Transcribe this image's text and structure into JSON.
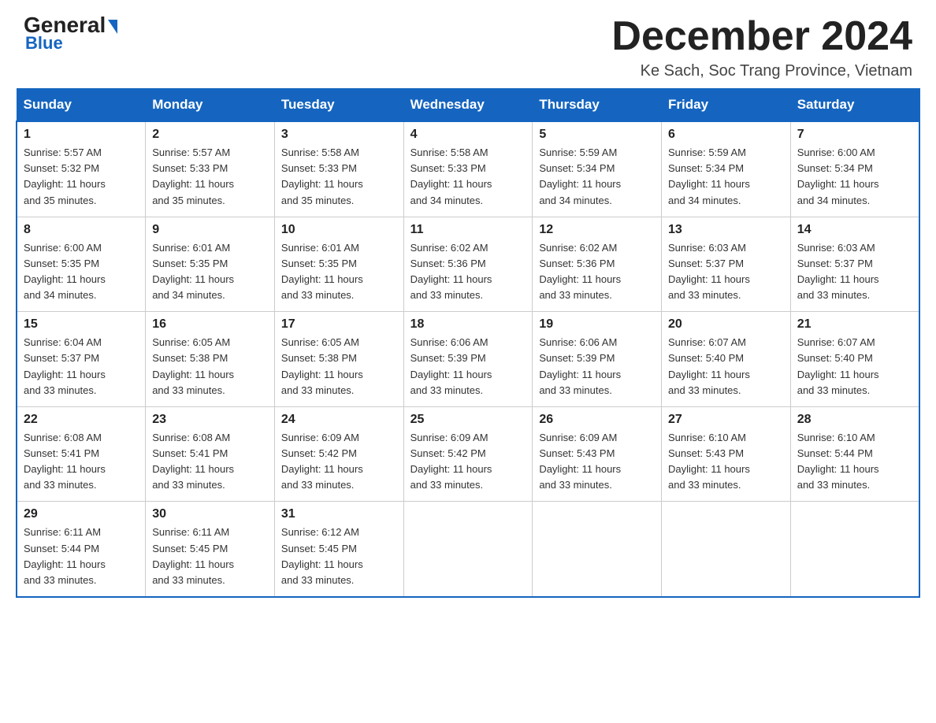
{
  "logo": {
    "name_part1": "General",
    "name_part2": "Blue"
  },
  "header": {
    "month": "December 2024",
    "location": "Ke Sach, Soc Trang Province, Vietnam"
  },
  "days_of_week": [
    "Sunday",
    "Monday",
    "Tuesday",
    "Wednesday",
    "Thursday",
    "Friday",
    "Saturday"
  ],
  "weeks": [
    [
      {
        "day": "1",
        "sunrise": "5:57 AM",
        "sunset": "5:32 PM",
        "daylight": "11 hours and 35 minutes."
      },
      {
        "day": "2",
        "sunrise": "5:57 AM",
        "sunset": "5:33 PM",
        "daylight": "11 hours and 35 minutes."
      },
      {
        "day": "3",
        "sunrise": "5:58 AM",
        "sunset": "5:33 PM",
        "daylight": "11 hours and 35 minutes."
      },
      {
        "day": "4",
        "sunrise": "5:58 AM",
        "sunset": "5:33 PM",
        "daylight": "11 hours and 34 minutes."
      },
      {
        "day": "5",
        "sunrise": "5:59 AM",
        "sunset": "5:34 PM",
        "daylight": "11 hours and 34 minutes."
      },
      {
        "day": "6",
        "sunrise": "5:59 AM",
        "sunset": "5:34 PM",
        "daylight": "11 hours and 34 minutes."
      },
      {
        "day": "7",
        "sunrise": "6:00 AM",
        "sunset": "5:34 PM",
        "daylight": "11 hours and 34 minutes."
      }
    ],
    [
      {
        "day": "8",
        "sunrise": "6:00 AM",
        "sunset": "5:35 PM",
        "daylight": "11 hours and 34 minutes."
      },
      {
        "day": "9",
        "sunrise": "6:01 AM",
        "sunset": "5:35 PM",
        "daylight": "11 hours and 34 minutes."
      },
      {
        "day": "10",
        "sunrise": "6:01 AM",
        "sunset": "5:35 PM",
        "daylight": "11 hours and 33 minutes."
      },
      {
        "day": "11",
        "sunrise": "6:02 AM",
        "sunset": "5:36 PM",
        "daylight": "11 hours and 33 minutes."
      },
      {
        "day": "12",
        "sunrise": "6:02 AM",
        "sunset": "5:36 PM",
        "daylight": "11 hours and 33 minutes."
      },
      {
        "day": "13",
        "sunrise": "6:03 AM",
        "sunset": "5:37 PM",
        "daylight": "11 hours and 33 minutes."
      },
      {
        "day": "14",
        "sunrise": "6:03 AM",
        "sunset": "5:37 PM",
        "daylight": "11 hours and 33 minutes."
      }
    ],
    [
      {
        "day": "15",
        "sunrise": "6:04 AM",
        "sunset": "5:37 PM",
        "daylight": "11 hours and 33 minutes."
      },
      {
        "day": "16",
        "sunrise": "6:05 AM",
        "sunset": "5:38 PM",
        "daylight": "11 hours and 33 minutes."
      },
      {
        "day": "17",
        "sunrise": "6:05 AM",
        "sunset": "5:38 PM",
        "daylight": "11 hours and 33 minutes."
      },
      {
        "day": "18",
        "sunrise": "6:06 AM",
        "sunset": "5:39 PM",
        "daylight": "11 hours and 33 minutes."
      },
      {
        "day": "19",
        "sunrise": "6:06 AM",
        "sunset": "5:39 PM",
        "daylight": "11 hours and 33 minutes."
      },
      {
        "day": "20",
        "sunrise": "6:07 AM",
        "sunset": "5:40 PM",
        "daylight": "11 hours and 33 minutes."
      },
      {
        "day": "21",
        "sunrise": "6:07 AM",
        "sunset": "5:40 PM",
        "daylight": "11 hours and 33 minutes."
      }
    ],
    [
      {
        "day": "22",
        "sunrise": "6:08 AM",
        "sunset": "5:41 PM",
        "daylight": "11 hours and 33 minutes."
      },
      {
        "day": "23",
        "sunrise": "6:08 AM",
        "sunset": "5:41 PM",
        "daylight": "11 hours and 33 minutes."
      },
      {
        "day": "24",
        "sunrise": "6:09 AM",
        "sunset": "5:42 PM",
        "daylight": "11 hours and 33 minutes."
      },
      {
        "day": "25",
        "sunrise": "6:09 AM",
        "sunset": "5:42 PM",
        "daylight": "11 hours and 33 minutes."
      },
      {
        "day": "26",
        "sunrise": "6:09 AM",
        "sunset": "5:43 PM",
        "daylight": "11 hours and 33 minutes."
      },
      {
        "day": "27",
        "sunrise": "6:10 AM",
        "sunset": "5:43 PM",
        "daylight": "11 hours and 33 minutes."
      },
      {
        "day": "28",
        "sunrise": "6:10 AM",
        "sunset": "5:44 PM",
        "daylight": "11 hours and 33 minutes."
      }
    ],
    [
      {
        "day": "29",
        "sunrise": "6:11 AM",
        "sunset": "5:44 PM",
        "daylight": "11 hours and 33 minutes."
      },
      {
        "day": "30",
        "sunrise": "6:11 AM",
        "sunset": "5:45 PM",
        "daylight": "11 hours and 33 minutes."
      },
      {
        "day": "31",
        "sunrise": "6:12 AM",
        "sunset": "5:45 PM",
        "daylight": "11 hours and 33 minutes."
      },
      null,
      null,
      null,
      null
    ]
  ],
  "labels": {
    "sunrise": "Sunrise:",
    "sunset": "Sunset:",
    "daylight": "Daylight:"
  }
}
